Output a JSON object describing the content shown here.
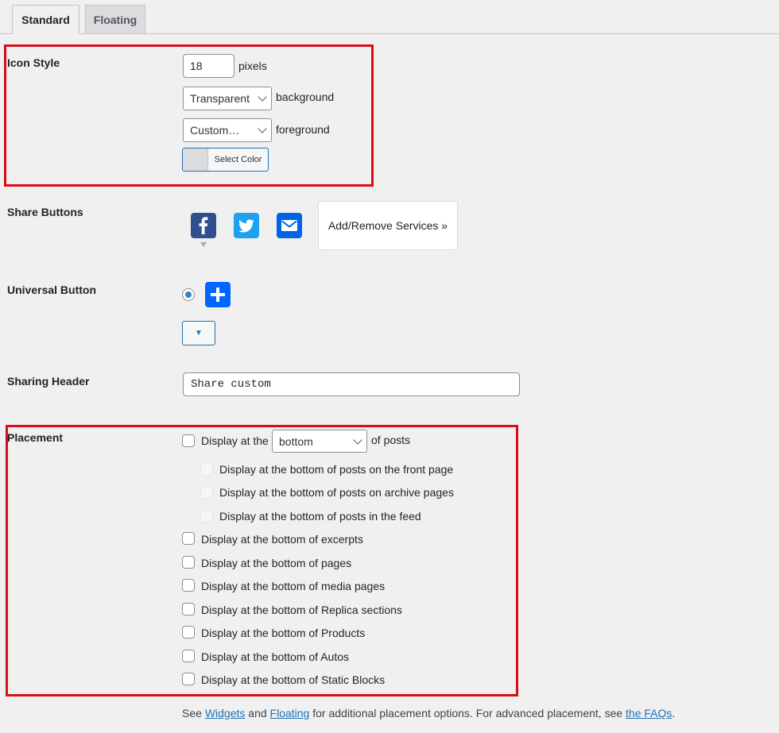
{
  "tabs": [
    {
      "label": "Standard",
      "active": true
    },
    {
      "label": "Floating",
      "active": false
    }
  ],
  "icon_style": {
    "label": "Icon Style",
    "size_value": "18",
    "size_unit": "pixels",
    "background_select": "Transparent",
    "background_label": "background",
    "foreground_select": "Custom…",
    "foreground_label": "foreground",
    "color_button_label": "Select Color"
  },
  "share_buttons": {
    "label": "Share Buttons",
    "services": [
      "facebook-icon",
      "twitter-icon",
      "email-icon"
    ],
    "add_remove_label": "Add/Remove Services »"
  },
  "universal_button": {
    "label": "Universal Button",
    "selected": true,
    "dropdown_glyph": "▼"
  },
  "sharing_header": {
    "label": "Sharing Header",
    "value": "Share custom"
  },
  "placement": {
    "label": "Placement",
    "display_at_prefix": "Display at the",
    "position_select": "bottom",
    "display_at_suffix": "of posts",
    "sub_options": [
      "Display at the bottom of posts on the front page",
      "Display at the bottom of posts on archive pages",
      "Display at the bottom of posts in the feed"
    ],
    "options": [
      "Display at the bottom of excerpts",
      "Display at the bottom of pages",
      "Display at the bottom of media pages",
      "Display at the bottom of Replica sections",
      "Display at the bottom of Products",
      "Display at the bottom of Autos",
      "Display at the bottom of Static Blocks"
    ]
  },
  "footer": {
    "see": "See",
    "widgets_link": "Widgets",
    "and": "and",
    "floating_link": "Floating",
    "middle": "for additional placement options. For advanced placement, see",
    "faqs_link": "the FAQs",
    "end": "."
  },
  "colors": {
    "highlight": "#d80d16",
    "facebook": "#2f4f8f",
    "twitter": "#1da1f2",
    "email": "#0064e6",
    "universal": "#0166ff",
    "link": "#2271b1"
  }
}
